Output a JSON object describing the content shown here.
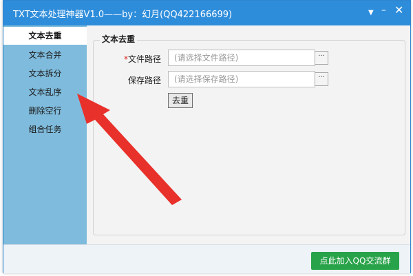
{
  "window": {
    "title": "TXT文本处理神器V1.0——by：幻月(QQ422166699)"
  },
  "titlebar_icons": {
    "menu": "▼",
    "minimize": "–",
    "close": "✕"
  },
  "sidebar": {
    "items": [
      {
        "label": "文本去重",
        "active": true
      },
      {
        "label": "文本合并",
        "active": false
      },
      {
        "label": "文本拆分",
        "active": false
      },
      {
        "label": "文本乱序",
        "active": false
      },
      {
        "label": "删除空行",
        "active": false
      },
      {
        "label": "组合任务",
        "active": false
      }
    ]
  },
  "panel": {
    "legend": "文本去重",
    "file_path": {
      "required_mark": "*",
      "label": "文件路径",
      "placeholder": "(请选择文件路径)",
      "value": ""
    },
    "save_path": {
      "label": "保存路径",
      "placeholder": "(请选择保存路径)",
      "value": ""
    },
    "browse_label": "···",
    "dedupe_button": "去重"
  },
  "footer": {
    "join_button": "点此加入QQ交流群"
  },
  "colors": {
    "titlebar": "#2e8ddb",
    "sidebar": "#7fbbdc",
    "join_button": "#29a34a",
    "arrow": "#e8312a"
  }
}
